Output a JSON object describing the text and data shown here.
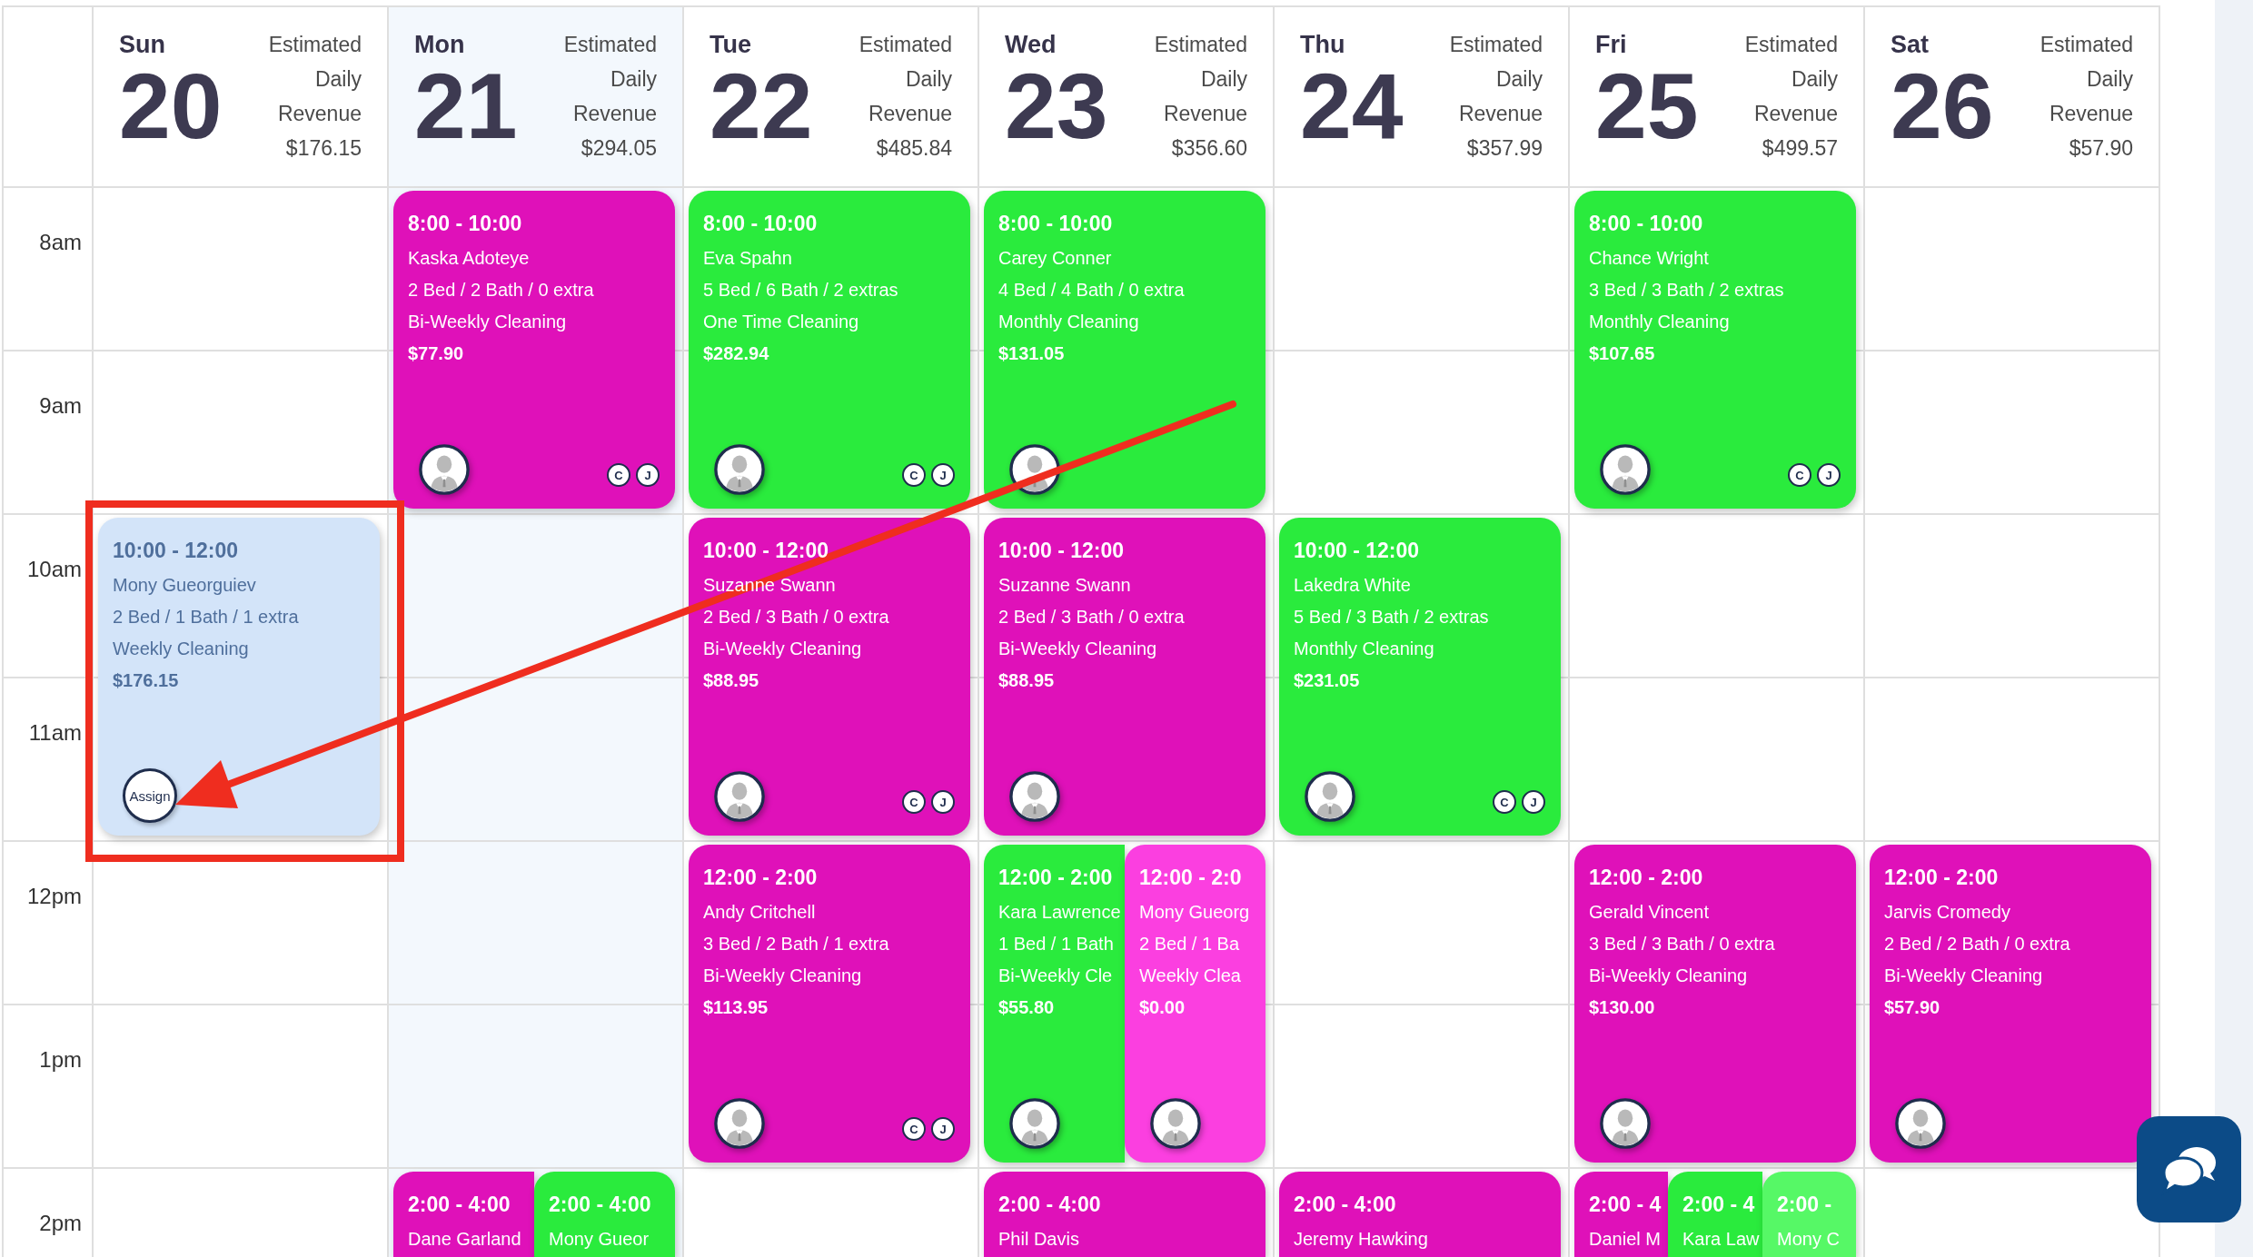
{
  "time_labels": [
    "8am",
    "9am",
    "10am",
    "11am",
    "12pm",
    "1pm",
    "2pm"
  ],
  "days": [
    {
      "weekday": "Sun",
      "date": "20",
      "revenue_label": "Estimated Daily Revenue",
      "revenue": "$176.15",
      "today": false,
      "blocks": [
        {
          "kind": "open"
        },
        {
          "kind": "booked",
          "appointments": [
            {
              "time": "10:00 - 12:00",
              "client": "Mony Gueorguiev",
              "rooms": "2 Bed / 1 Bath / 1 extra",
              "service": "Weekly Cleaning",
              "price": "$176.15",
              "color": "#d3e4f9",
              "assigned": false,
              "assign_label": "Assign"
            }
          ]
        },
        {
          "kind": "open"
        },
        {
          "kind": "open"
        }
      ]
    },
    {
      "weekday": "Mon",
      "date": "21",
      "revenue_label": "Estimated Daily Revenue",
      "revenue": "$294.05",
      "today": true,
      "blocks": [
        {
          "kind": "booked",
          "appointments": [
            {
              "time": "8:00 - 10:00",
              "client": "Kaska Adoteye",
              "rooms": "2 Bed / 2 Bath / 0 extra",
              "service": "Bi-Weekly Cleaning",
              "price": "$77.90",
              "color": "#df11b9",
              "assigned": true,
              "staff": [
                "C",
                "J"
              ]
            }
          ]
        },
        {
          "kind": "open"
        },
        {
          "kind": "open"
        },
        {
          "kind": "booked",
          "appointments": [
            {
              "time": "2:00 - 4:00",
              "client": "Dane Garland",
              "color": "#df11b9"
            },
            {
              "time": "2:00 - 4:00",
              "client": "Mony Gueor",
              "color": "#2aeb3d"
            }
          ]
        }
      ]
    },
    {
      "weekday": "Tue",
      "date": "22",
      "revenue_label": "Estimated Daily Revenue",
      "revenue": "$485.84",
      "today": false,
      "blocks": [
        {
          "kind": "booked",
          "appointments": [
            {
              "time": "8:00 - 10:00",
              "client": "Eva Spahn",
              "rooms": "5 Bed / 6 Bath / 2 extras",
              "service": "One Time Cleaning",
              "price": "$282.94",
              "color": "#2aeb3d",
              "assigned": true,
              "staff": [
                "C",
                "J"
              ]
            }
          ]
        },
        {
          "kind": "booked",
          "appointments": [
            {
              "time": "10:00 - 12:00",
              "client": "Suzanne Swann",
              "rooms": "2 Bed / 3 Bath / 0 extra",
              "service": "Bi-Weekly Cleaning",
              "price": "$88.95",
              "color": "#df11b9",
              "assigned": true,
              "staff": [
                "C",
                "J"
              ]
            }
          ]
        },
        {
          "kind": "booked",
          "appointments": [
            {
              "time": "12:00 - 2:00",
              "client": "Andy Critchell",
              "rooms": "3 Bed / 2 Bath / 1 extra",
              "service": "Bi-Weekly Cleaning",
              "price": "$113.95",
              "color": "#df11b9",
              "assigned": true,
              "staff": [
                "C",
                "J"
              ]
            }
          ]
        },
        {
          "kind": "open"
        }
      ]
    },
    {
      "weekday": "Wed",
      "date": "23",
      "revenue_label": "Estimated Daily Revenue",
      "revenue": "$356.60",
      "today": false,
      "blocks": [
        {
          "kind": "booked",
          "appointments": [
            {
              "time": "8:00 - 10:00",
              "client": "Carey Conner",
              "rooms": "4 Bed / 4 Bath / 0 extra",
              "service": "Monthly Cleaning",
              "price": "$131.05",
              "color": "#2aeb3d",
              "assigned": true
            }
          ]
        },
        {
          "kind": "booked",
          "appointments": [
            {
              "time": "10:00 - 12:00",
              "client": "Suzanne Swann",
              "rooms": "2 Bed / 3 Bath / 0 extra",
              "service": "Bi-Weekly Cleaning",
              "price": "$88.95",
              "color": "#df11b9",
              "assigned": true
            }
          ]
        },
        {
          "kind": "booked",
          "appointments": [
            {
              "time": "12:00 - 2:00",
              "client": "Kara Lawrence",
              "rooms": "1 Bed / 1 Bath",
              "service": "Bi-Weekly Cle",
              "price": "$55.80",
              "color": "#2aeb3d",
              "assigned": true
            },
            {
              "time": "12:00 - 2:0",
              "client": "Mony Gueorg",
              "rooms": "2 Bed / 1 Ba",
              "service": "Weekly Clea",
              "price": "$0.00",
              "color": "#fb3fe0",
              "assigned": true
            }
          ]
        },
        {
          "kind": "booked",
          "appointments": [
            {
              "time": "2:00 - 4:00",
              "client": "Phil Davis",
              "color": "#df11b9"
            }
          ]
        }
      ]
    },
    {
      "weekday": "Thu",
      "date": "24",
      "revenue_label": "Estimated Daily Revenue",
      "revenue": "$357.99",
      "today": false,
      "blocks": [
        {
          "kind": "open"
        },
        {
          "kind": "booked",
          "appointments": [
            {
              "time": "10:00 - 12:00",
              "client": "Lakedra White",
              "rooms": "5 Bed / 3 Bath / 2 extras",
              "service": "Monthly Cleaning",
              "price": "$231.05",
              "color": "#2aeb3d",
              "assigned": true,
              "staff": [
                "C",
                "J"
              ]
            }
          ]
        },
        {
          "kind": "open"
        },
        {
          "kind": "booked",
          "appointments": [
            {
              "time": "2:00 - 4:00",
              "client": "Jeremy Hawking",
              "color": "#df11b9"
            }
          ]
        }
      ]
    },
    {
      "weekday": "Fri",
      "date": "25",
      "revenue_label": "Estimated Daily Revenue",
      "revenue": "$499.57",
      "today": false,
      "blocks": [
        {
          "kind": "booked",
          "appointments": [
            {
              "time": "8:00 - 10:00",
              "client": "Chance Wright",
              "rooms": "3 Bed / 3 Bath / 2 extras",
              "service": "Monthly Cleaning",
              "price": "$107.65",
              "color": "#2aeb3d",
              "assigned": true,
              "staff": [
                "C",
                "J"
              ]
            }
          ]
        },
        {
          "kind": "open"
        },
        {
          "kind": "booked",
          "appointments": [
            {
              "time": "12:00 - 2:00",
              "client": "Gerald Vincent",
              "rooms": "3 Bed / 3 Bath / 0 extra",
              "service": "Bi-Weekly Cleaning",
              "price": "$130.00",
              "color": "#df11b9",
              "assigned": true
            }
          ]
        },
        {
          "kind": "booked",
          "appointments": [
            {
              "time": "2:00 - 4",
              "client": "Daniel M",
              "color": "#df11b9"
            },
            {
              "time": "2:00 - 4",
              "client": "Kara Law",
              "color": "#2aeb3d"
            },
            {
              "time": "2:00 -",
              "client": "Mony C",
              "color": "#56f866"
            }
          ]
        }
      ]
    },
    {
      "weekday": "Sat",
      "date": "26",
      "revenue_label": "Estimated Daily Revenue",
      "revenue": "$57.90",
      "today": false,
      "blocks": [
        {
          "kind": "open"
        },
        {
          "kind": "open"
        },
        {
          "kind": "booked",
          "appointments": [
            {
              "time": "12:00 - 2:00",
              "client": "Jarvis Cromedy",
              "rooms": "2 Bed / 2 Bath / 0 extra",
              "service": "Bi-Weekly Cleaning",
              "price": "$57.90",
              "color": "#df11b9",
              "assigned": true
            }
          ]
        },
        {
          "kind": "open"
        }
      ]
    }
  ],
  "annotations": {
    "frame": true,
    "arrow": true
  },
  "floating_buttons": [
    {
      "kind": "chat"
    }
  ]
}
